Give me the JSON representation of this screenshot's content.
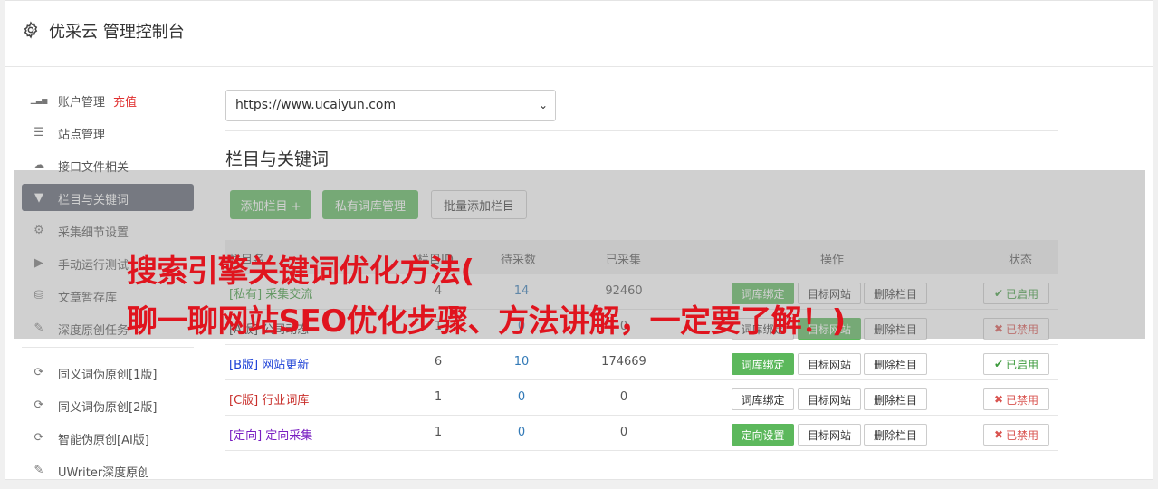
{
  "app": {
    "title": "优采云 管理控制台",
    "icon": "gear-icon"
  },
  "sidebar": {
    "items": [
      {
        "icon": "bar-chart-icon",
        "label": "账户管理",
        "extra": "充值"
      },
      {
        "icon": "server-icon",
        "label": "站点管理"
      },
      {
        "icon": "cloud-upload-icon",
        "label": "接口文件相关"
      },
      {
        "icon": "filter-icon",
        "label": "栏目与关键词",
        "active": true
      },
      {
        "icon": "gears-icon",
        "label": "采集细节设置"
      },
      {
        "icon": "play-circle-icon",
        "label": "手动运行测试"
      },
      {
        "icon": "database-icon",
        "label": "文章暂存库"
      },
      {
        "icon": "edit-icon",
        "label": "深度原创任务"
      },
      {
        "icon": "refresh-icon",
        "label": "同义词伪原创[1版]"
      },
      {
        "icon": "refresh-icon",
        "label": "同义词伪原创[2版]"
      },
      {
        "icon": "refresh-icon",
        "label": "智能伪原创[AI版]"
      },
      {
        "icon": "edit-icon",
        "label": "UWriter深度原创"
      }
    ]
  },
  "site_select": {
    "value": "https://www.ucaiyun.com",
    "icon": "chevron-down-icon"
  },
  "section_title": "栏目与关键词",
  "toolbar": {
    "add_column": "添加栏目 +",
    "private_lib": "私有词库管理",
    "batch_add": "批量添加栏目"
  },
  "table": {
    "headers": {
      "name": "栏目名",
      "id": "栏目ID",
      "pending": "待采数",
      "collected": "已采集",
      "ops": "操作",
      "status": "状态"
    },
    "rows": [
      {
        "tag": "[私有]",
        "name": "采集交流",
        "color": "#3c9a3c",
        "id": "4",
        "pending": "14",
        "collected": "92460",
        "op1": "词库绑定",
        "op1_green": true,
        "op2": "目标网站",
        "op2_green": false,
        "op3": "删除栏目",
        "status": "已启用",
        "enabled": true
      },
      {
        "tag": "[A版]",
        "name": "公司动态",
        "color": "#333333",
        "id": "1",
        "pending": "0",
        "collected": "0",
        "op1": "词库绑定",
        "op1_green": false,
        "op2": "目标网站",
        "op2_green": true,
        "op3": "删除栏目",
        "status": "已禁用",
        "enabled": false
      },
      {
        "tag": "[B版]",
        "name": "网站更新",
        "color": "#1a3fd6",
        "id": "6",
        "pending": "10",
        "collected": "174669",
        "op1": "词库绑定",
        "op1_green": true,
        "op2": "目标网站",
        "op2_green": false,
        "op3": "删除栏目",
        "status": "已启用",
        "enabled": true
      },
      {
        "tag": "[C版]",
        "name": "行业词库",
        "color": "#c9302c",
        "id": "1",
        "pending": "0",
        "collected": "0",
        "op1": "词库绑定",
        "op1_green": false,
        "op2": "目标网站",
        "op2_green": false,
        "op3": "删除栏目",
        "status": "已禁用",
        "enabled": false
      },
      {
        "tag": "[定向]",
        "name": "定向采集",
        "color": "#7a1fc2",
        "id": "1",
        "pending": "0",
        "collected": "0",
        "op1": "定向设置",
        "op1_green": true,
        "op2": "目标网站",
        "op2_green": false,
        "op3": "删除栏目",
        "status": "已禁用",
        "enabled": false
      }
    ]
  },
  "headline": {
    "line1": "搜索引擎关键词优化方法(",
    "line2": "聊一聊网站SEO优化步骤、方法讲解，一定要了解！)"
  }
}
